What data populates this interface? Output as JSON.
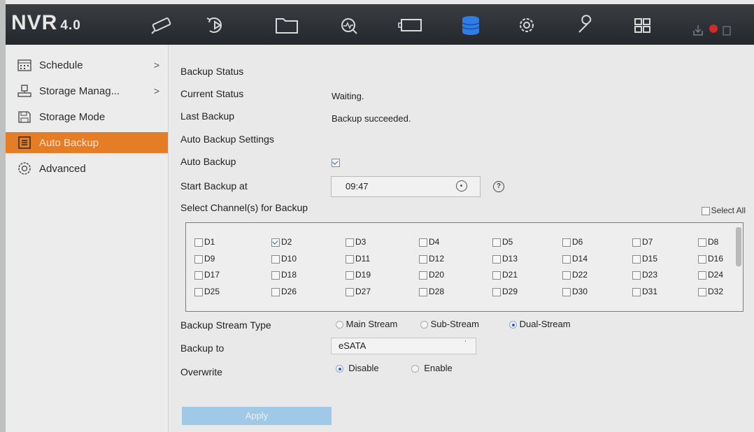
{
  "header": {
    "logo": "NVR",
    "version": "4.0",
    "icons": [
      "live-view-icon",
      "playback-icon",
      "file-management-icon",
      "smart-analysis-icon",
      "monitor-icon",
      "storage-icon",
      "configuration-icon",
      "maintenance-icon",
      "multi-view-icon"
    ]
  },
  "sidebar": {
    "items": [
      {
        "label": "Schedule",
        "icon": "calendar-icon",
        "arrow": ">"
      },
      {
        "label": "Storage Manag...",
        "icon": "storage-manage-icon",
        "arrow": ">"
      },
      {
        "label": "Storage Mode",
        "icon": "save-icon",
        "arrow": ""
      },
      {
        "label": "Auto Backup",
        "icon": "backup-icon",
        "arrow": ""
      },
      {
        "label": "Advanced",
        "icon": "gear-icon",
        "arrow": ""
      }
    ]
  },
  "main": {
    "backup_status_heading": "Backup Status",
    "current_status_label": "Current Status",
    "current_status_value": "Waiting.",
    "last_backup_label": "Last Backup",
    "last_backup_value": "Backup succeeded.",
    "settings_heading": "Auto Backup Settings",
    "auto_backup_label": "Auto Backup",
    "auto_backup_enabled": true,
    "start_backup_label": "Start Backup at",
    "start_backup_value": "09:47",
    "help": "?",
    "select_channels_label": "Select Channel(s) for Backup",
    "select_all_label": "Select All",
    "channels": [
      {
        "label": "D1",
        "checked": false
      },
      {
        "label": "D2",
        "checked": true
      },
      {
        "label": "D3",
        "checked": false
      },
      {
        "label": "D4",
        "checked": false
      },
      {
        "label": "D5",
        "checked": false
      },
      {
        "label": "D6",
        "checked": false
      },
      {
        "label": "D7",
        "checked": false
      },
      {
        "label": "D8",
        "checked": false
      },
      {
        "label": "D9",
        "checked": false
      },
      {
        "label": "D10",
        "checked": false
      },
      {
        "label": "D11",
        "checked": false
      },
      {
        "label": "D12",
        "checked": false
      },
      {
        "label": "D13",
        "checked": false
      },
      {
        "label": "D14",
        "checked": false
      },
      {
        "label": "D15",
        "checked": false
      },
      {
        "label": "D16",
        "checked": false
      },
      {
        "label": "D17",
        "checked": false
      },
      {
        "label": "D18",
        "checked": false
      },
      {
        "label": "D19",
        "checked": false
      },
      {
        "label": "D20",
        "checked": false
      },
      {
        "label": "D21",
        "checked": false
      },
      {
        "label": "D22",
        "checked": false
      },
      {
        "label": "D23",
        "checked": false
      },
      {
        "label": "D24",
        "checked": false
      },
      {
        "label": "D25",
        "checked": false
      },
      {
        "label": "D26",
        "checked": false
      },
      {
        "label": "D27",
        "checked": false
      },
      {
        "label": "D28",
        "checked": false
      },
      {
        "label": "D29",
        "checked": false
      },
      {
        "label": "D30",
        "checked": false
      },
      {
        "label": "D31",
        "checked": false
      },
      {
        "label": "D32",
        "checked": false
      }
    ],
    "stream_type_label": "Backup Stream Type",
    "stream_options": [
      "Main Stream",
      "Sub-Stream",
      "Dual-Stream"
    ],
    "stream_selected": "Dual-Stream",
    "backup_to_label": "Backup to",
    "backup_to_value": "eSATA",
    "overwrite_label": "Overwrite",
    "overwrite_options": [
      "Disable",
      "Enable"
    ],
    "overwrite_selected": "Disable",
    "apply_label": "Apply"
  },
  "colors": {
    "accent": "#e47d26",
    "topbar": "#2e3136",
    "apply_button": "#9fc9e6"
  }
}
